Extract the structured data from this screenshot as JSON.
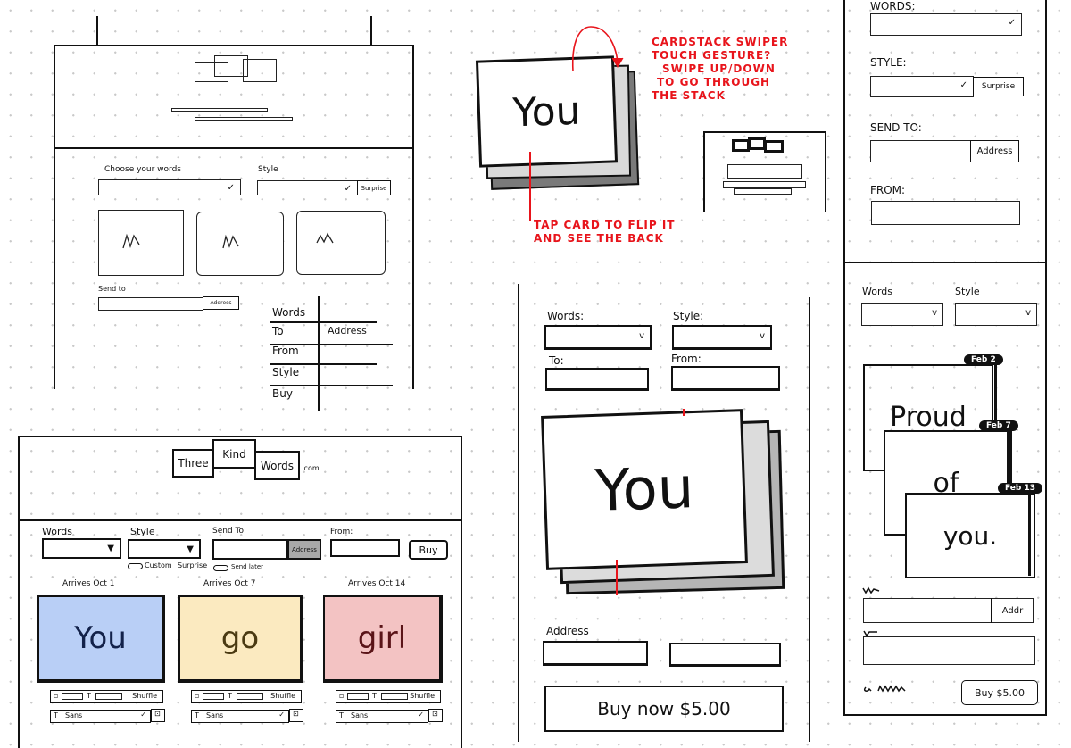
{
  "sketch_desktop_a": {
    "words_label": "Choose your words",
    "style_label": "Style",
    "surprise_button": "Surprise",
    "send_to_label": "Send to",
    "address_button": "Address",
    "table_rows": [
      {
        "label": "Words",
        "value": ""
      },
      {
        "label": "To",
        "value": "Address"
      },
      {
        "label": "From",
        "value": ""
      },
      {
        "label": "Style",
        "value": ""
      },
      {
        "label": "Buy",
        "value": ""
      }
    ]
  },
  "sketch_desktop_b": {
    "logo": [
      "Three",
      "Kind",
      "Words",
      ".com"
    ],
    "words_label": "Words",
    "style_label": "Style",
    "send_to_label": "Send To:",
    "from_label": "From:",
    "address_button": "Address",
    "buy_button": "Buy",
    "custom_toggle": "Custom",
    "surprise_link": "Surprise",
    "send_later_toggle": "Send later",
    "cards": [
      {
        "arrives": "Arrives Oct 1",
        "word": "You",
        "color": "#b9cff6",
        "ink": "#13224a",
        "font": "Sans",
        "shuffle": "Shuffle"
      },
      {
        "arrives": "Arrives Oct 7",
        "word": "go",
        "color": "#fbeac0",
        "ink": "#4a3a12",
        "font": "Sans",
        "shuffle": "Shuffle"
      },
      {
        "arrives": "Arrives Oct 14",
        "word": "girl",
        "color": "#f3c3c3",
        "ink": "#5a1418",
        "font": "Sans",
        "shuffle": "Shuffle"
      }
    ]
  },
  "card_stack_sketch": {
    "word": "You",
    "note_swipe": [
      "CARDSTACK SWIPER",
      "TOUCH GESTURE?",
      "SWIPE UP/DOWN",
      "TO GO THROUGH",
      "THE STACK"
    ],
    "note_tap": [
      "TAP CARD TO FLIP IT",
      "AND SEE THE BACK"
    ],
    "annotation_color": "#e8141b"
  },
  "mobile_a": {
    "words_label": "Words:",
    "style_label": "Style:",
    "to_label": "To:",
    "from_label": "From:",
    "card_word": "You",
    "address_label": "Address",
    "buy_button": "Buy now $5.00"
  },
  "mobile_b": {
    "words_label": "WORDS:",
    "style_label": "STYLE:",
    "surprise_button": "Surprise",
    "send_to_label": "SEND TO:",
    "address_button": "Address",
    "from_label": "FROM:"
  },
  "mobile_c": {
    "words_label": "Words",
    "style_label": "Style",
    "cards": [
      {
        "date": "Feb 2",
        "word": "Proud"
      },
      {
        "date": "Feb 7",
        "word": "of"
      },
      {
        "date": "Feb 13",
        "word": "you."
      }
    ],
    "address_button": "Addr",
    "buy_button": "Buy $5.00"
  }
}
